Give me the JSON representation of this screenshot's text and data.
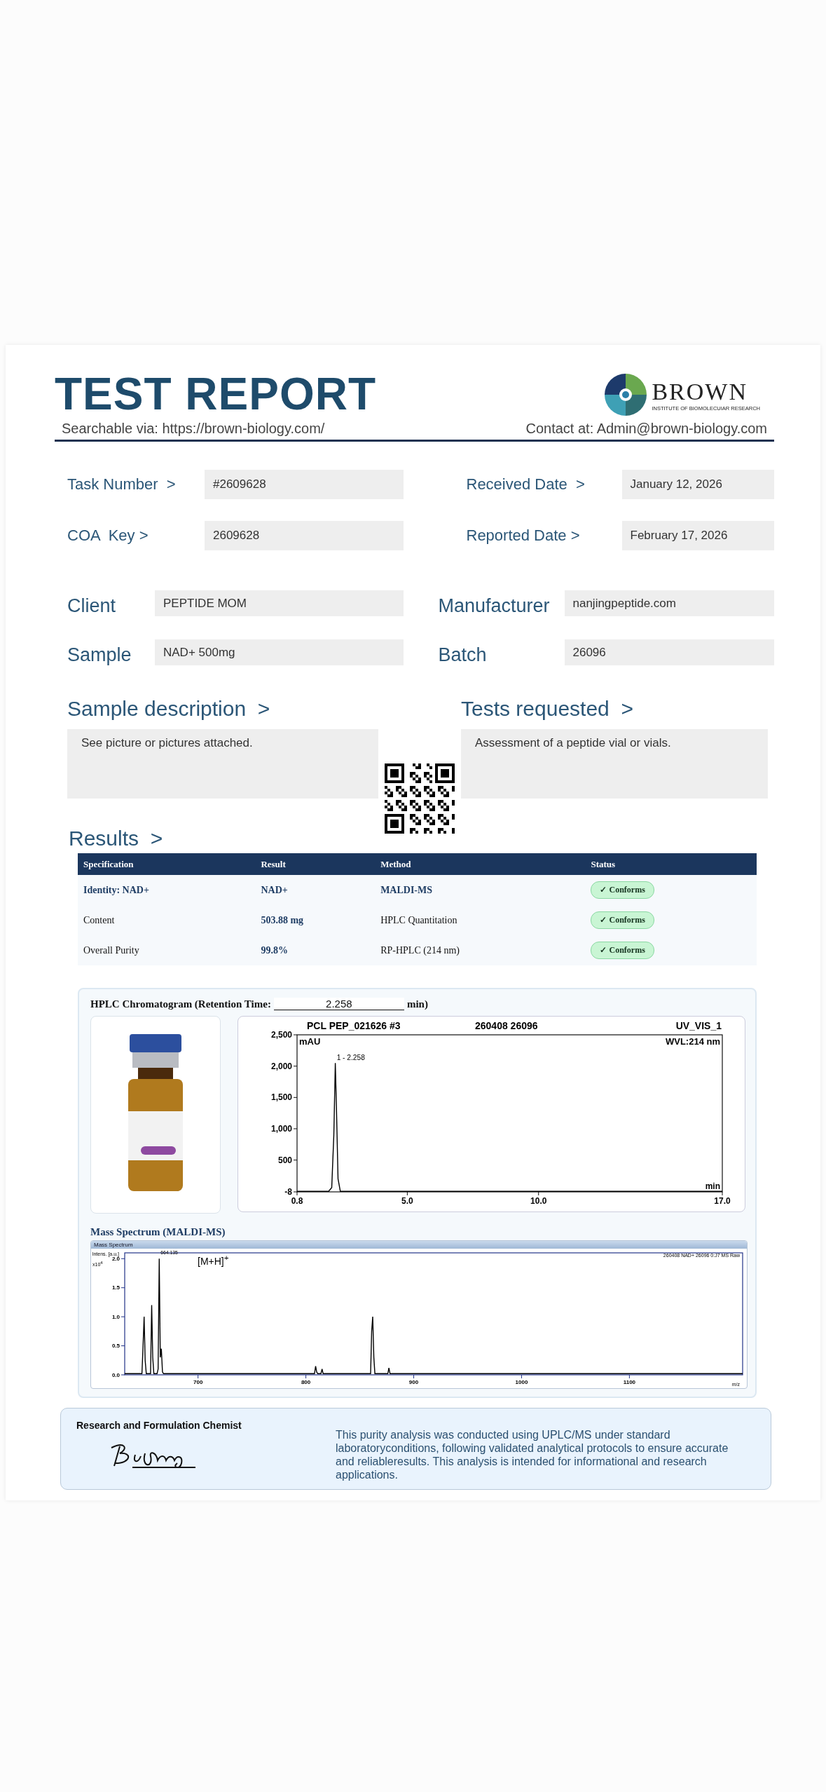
{
  "header": {
    "title": "TEST REPORT",
    "search_line": "Searchable via: https://brown-biology.com/",
    "contact_line": "Contact at: Admin@brown-biology.com",
    "logo": {
      "name": "BROWN",
      "subtitle": "INSTITUTE OF BIOMOLECUIAR RESEARCH"
    }
  },
  "key_fields": [
    {
      "label": "Task Number  >",
      "value": "#2609628"
    },
    {
      "label": "Received Date  >",
      "value": "January 12, 2026"
    },
    {
      "label": "COA  Key >",
      "value": "2609628"
    },
    {
      "label": "Reported Date >",
      "value": "February 17, 2026"
    }
  ],
  "party_fields": [
    {
      "label": "Client",
      "value": "PEPTIDE MOM"
    },
    {
      "label": "Manufacturer",
      "value": "nanjingpeptide.com"
    },
    {
      "label": "Sample",
      "value": "NAD+ 500mg"
    },
    {
      "label": "Batch",
      "value": "26096"
    }
  ],
  "sample_description": {
    "title": "Sample description  >",
    "text": "See picture or pictures attached."
  },
  "tests_requested": {
    "title": "Tests requested  >",
    "text": "Assessment of a peptide vial or vials."
  },
  "results": {
    "title": "Results  >",
    "columns": [
      "Specification",
      "Result",
      "Method",
      "Status"
    ],
    "rows": [
      {
        "highlight": true,
        "cells": [
          "Identity:  NAD+",
          "NAD+",
          "MALDI-MS"
        ],
        "status": {
          "kind": "conforms",
          "label": "✓ Conforms"
        }
      },
      {
        "highlight": false,
        "cells": [
          "Content",
          "503.88  mg",
          "HPLC Quantitation"
        ],
        "status": {
          "kind": "conforms",
          "label": "✓ Conforms"
        }
      },
      {
        "highlight": false,
        "cells": [
          "Overall Purity",
          "99.8%",
          "RP-HPLC (214 nm)"
        ],
        "status": {
          "kind": "conforms",
          "label": "✓ Conforms"
        }
      }
    ]
  },
  "hplc": {
    "caption_prefix": "HPLC Chromatogram (Retention Time:",
    "retention_time": "2.258",
    "caption_suffix": "min)",
    "run_id": "PCL PEP_021626 #3",
    "sample_id": "260408 26096",
    "channel": "UV_VIS_1",
    "wavelength": "WVL:214 nm",
    "chart_data": {
      "type": "line",
      "xlabel": "min",
      "ylabel": "mAU",
      "x": [
        0.8,
        2.0,
        2.12,
        2.2,
        2.258,
        2.3,
        2.36,
        2.45,
        17.0
      ],
      "series": [
        {
          "color": "#000000",
          "values": [
            0,
            0,
            60,
            900,
            2050,
            1350,
            200,
            0,
            0
          ]
        }
      ],
      "xlim": [
        0.8,
        17.0
      ],
      "ylim": [
        -8,
        2500
      ],
      "xticks": [
        {
          "value": 0.8,
          "label": "0.8"
        },
        {
          "value": 5.0,
          "label": "5.0"
        },
        {
          "value": 10.0,
          "label": "10.0"
        },
        {
          "value": 17.0,
          "label": "17.0"
        }
      ],
      "yticks": [
        {
          "value": -8,
          "label": "-8"
        },
        {
          "value": 500,
          "label": "500"
        },
        {
          "value": 1000,
          "label": "1,000"
        },
        {
          "value": 1500,
          "label": "1,500"
        },
        {
          "value": 2000,
          "label": "2,000"
        },
        {
          "value": 2500,
          "label": "2,500"
        }
      ],
      "annotations": [
        {
          "x": 2.258,
          "y": 2050,
          "text": "1 - 2.258"
        }
      ]
    }
  },
  "mass_spectrum": {
    "title": "Mass Spectrum (MALDI-MS)",
    "panel_title": "Mass Spectrum",
    "run_label": "260408 NAD+ 26096 0:J7 MS Raw",
    "ion_label": "[M+H]$^{+}$",
    "scale_label": "x10$^{4}$",
    "chart_data": {
      "type": "line",
      "xlabel": "m/z",
      "ylabel": "Intens. [a.u.]",
      "x": [
        632,
        648,
        649,
        650,
        651,
        652,
        656,
        657,
        658,
        659,
        662,
        663,
        664,
        665,
        666,
        667,
        668,
        700,
        808,
        809,
        810,
        811,
        814,
        815,
        816,
        860,
        861,
        862,
        863,
        864,
        876,
        877,
        878,
        1205
      ],
      "series": [
        {
          "color": "#000000",
          "values": [
            0.02,
            0.02,
            0.5,
            1.0,
            0.25,
            0.02,
            0.02,
            1.2,
            0.3,
            0.02,
            0.02,
            0.1,
            2.0,
            0.3,
            0.45,
            0.05,
            0.02,
            0.02,
            0.02,
            0.15,
            0.05,
            0.02,
            0.02,
            0.1,
            0.02,
            0.02,
            0.75,
            1.0,
            0.3,
            0.02,
            0.02,
            0.12,
            0.02,
            0.02
          ]
        }
      ],
      "xlim": [
        632,
        1205
      ],
      "ylim": [
        0,
        2.1
      ],
      "xticks": [
        700,
        800,
        900,
        1000,
        1100
      ],
      "yticks": [
        {
          "value": 0,
          "label": "0.0"
        },
        {
          "value": 0.5,
          "label": "0.5"
        },
        {
          "value": 1.0,
          "label": "1.0"
        },
        {
          "value": 1.5,
          "label": "1.5"
        },
        {
          "value": 2.0,
          "label": "2.0"
        }
      ],
      "annotations": [
        {
          "x": 664,
          "y": 2.0,
          "text": "664.135"
        }
      ]
    }
  },
  "footer": {
    "role": "Research and Formulation Chemist",
    "statement": "This purity analysis was conducted using UPLC/MS under standard laboratoryconditions, following validated analytical protocols to ensure accurate and reliableresults. This analysis is intended for informational and research applications."
  }
}
